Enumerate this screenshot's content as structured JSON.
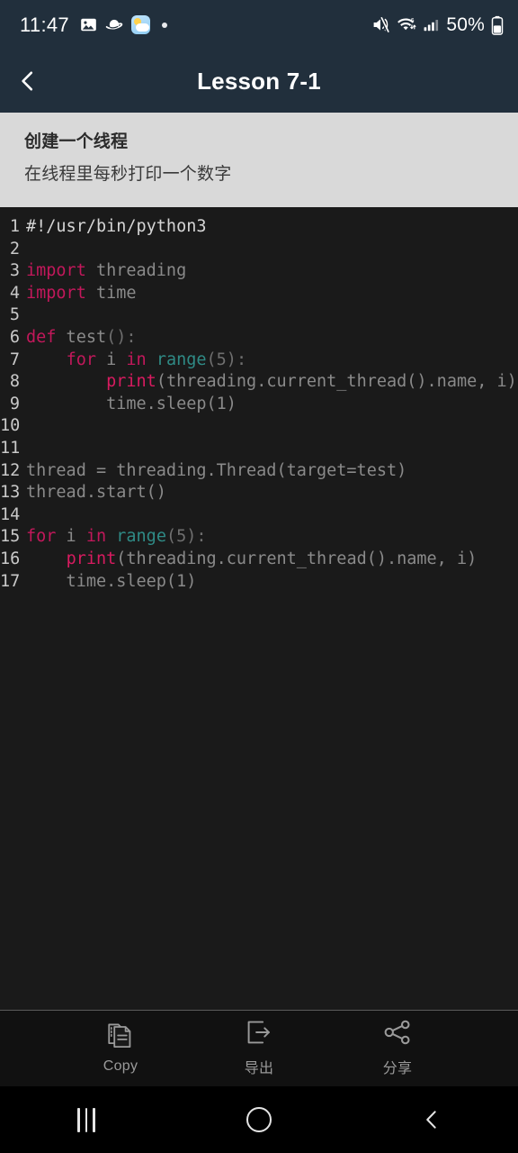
{
  "statusbar": {
    "time": "11:47",
    "battery_percent": "50%",
    "left_icons": [
      "gallery-icon",
      "planet-icon",
      "weather-app-icon",
      "notification-dot-icon"
    ],
    "right_icons": [
      "mute-icon",
      "wifi-6-icon",
      "cellular-signal-icon",
      "battery-icon"
    ],
    "bg_color": "#212f3c"
  },
  "header": {
    "title": "Lesson 7-1",
    "back_icon": "chevron-left-icon",
    "bg_color": "#212f3c"
  },
  "description": {
    "title": "创建一个线程",
    "subtitle": "在线程里每秒打印一个数字",
    "bg_color": "#d9d9d9"
  },
  "editor": {
    "bg_color": "#1a1a1a",
    "language": "python",
    "lines": [
      {
        "n": "1",
        "tokens": [
          {
            "t": "#!/usr/bin/python3",
            "c": "first"
          }
        ]
      },
      {
        "n": "2",
        "tokens": []
      },
      {
        "n": "3",
        "tokens": [
          {
            "t": "import",
            "c": "kw"
          },
          {
            "t": " threading",
            "c": ""
          }
        ]
      },
      {
        "n": "4",
        "tokens": [
          {
            "t": "import",
            "c": "kw"
          },
          {
            "t": " time",
            "c": ""
          }
        ]
      },
      {
        "n": "5",
        "tokens": []
      },
      {
        "n": "6",
        "tokens": [
          {
            "t": "def",
            "c": "kw"
          },
          {
            "t": " test",
            "c": ""
          },
          {
            "t": "():",
            "c": "pn"
          }
        ]
      },
      {
        "n": "7",
        "tokens": [
          {
            "t": "    ",
            "c": ""
          },
          {
            "t": "for",
            "c": "kw"
          },
          {
            "t": " i ",
            "c": ""
          },
          {
            "t": "in",
            "c": "kw"
          },
          {
            "t": " ",
            "c": ""
          },
          {
            "t": "range",
            "c": "bi"
          },
          {
            "t": "(5):",
            "c": "pn"
          }
        ]
      },
      {
        "n": "8",
        "tokens": [
          {
            "t": "        ",
            "c": ""
          },
          {
            "t": "print",
            "c": "fn"
          },
          {
            "t": "(threading.current_thread().name, i)",
            "c": ""
          }
        ]
      },
      {
        "n": "9",
        "tokens": [
          {
            "t": "        time.sleep(1)",
            "c": ""
          }
        ]
      },
      {
        "n": "10",
        "tokens": []
      },
      {
        "n": "11",
        "tokens": []
      },
      {
        "n": "12",
        "tokens": [
          {
            "t": "thread = threading.Thread(target=test)",
            "c": ""
          }
        ]
      },
      {
        "n": "13",
        "tokens": [
          {
            "t": "thread.start()",
            "c": ""
          }
        ]
      },
      {
        "n": "14",
        "tokens": []
      },
      {
        "n": "15",
        "tokens": [
          {
            "t": "for",
            "c": "kw"
          },
          {
            "t": " i ",
            "c": ""
          },
          {
            "t": "in",
            "c": "kw"
          },
          {
            "t": " ",
            "c": ""
          },
          {
            "t": "range",
            "c": "bi"
          },
          {
            "t": "(5):",
            "c": "pn"
          }
        ]
      },
      {
        "n": "16",
        "tokens": [
          {
            "t": "    ",
            "c": ""
          },
          {
            "t": "print",
            "c": "fn"
          },
          {
            "t": "(threading.current_thread().name, i)",
            "c": ""
          }
        ]
      },
      {
        "n": "17",
        "tokens": [
          {
            "t": "    time.sleep(1)",
            "c": ""
          }
        ]
      }
    ]
  },
  "toolbar": {
    "buttons": [
      {
        "label": "Copy",
        "icon": "copy-icon"
      },
      {
        "label": "导出",
        "icon": "export-icon"
      },
      {
        "label": "分享",
        "icon": "share-icon"
      }
    ]
  },
  "navbar": {
    "recents_label": "recents-icon",
    "home_label": "home-icon",
    "back_label": "back-icon"
  }
}
